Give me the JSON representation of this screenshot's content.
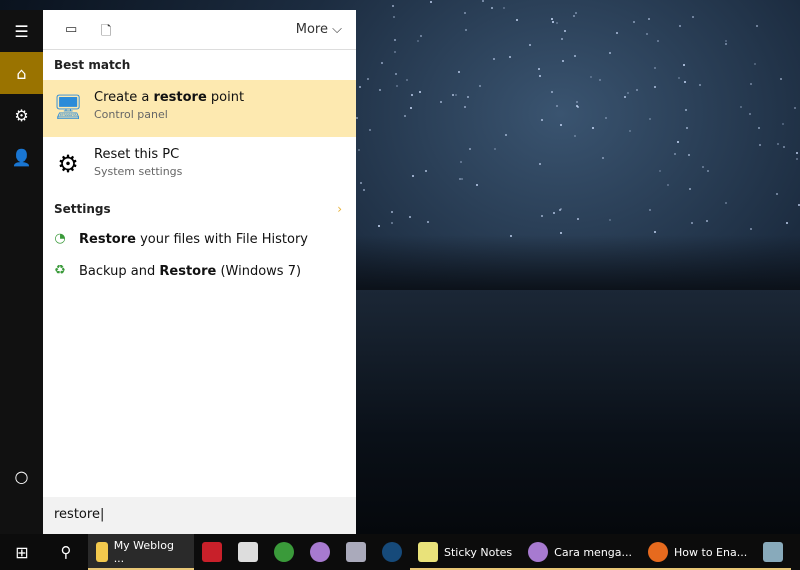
{
  "panel": {
    "more_label": "More",
    "best_match_heading": "Best match",
    "settings_heading": "Settings",
    "best_match": [
      {
        "title_pre": "Create a ",
        "title_bold": "restore",
        "title_post": " point",
        "subtitle": "Control panel"
      },
      {
        "title": "Reset this PC",
        "subtitle": "System settings"
      }
    ],
    "settings": [
      {
        "bold": "Restore",
        "rest": " your files with File History"
      },
      {
        "pre": "Backup and ",
        "bold": "Restore",
        "rest": " (Windows 7)"
      }
    ]
  },
  "search": {
    "value": "restore"
  },
  "taskbar": {
    "items": [
      "My Weblog ...",
      "Sticky Notes",
      "Cara menga...",
      "How to Ena..."
    ]
  },
  "colors": {
    "accent": "#9a7300",
    "highlight": "#fde9b0"
  }
}
